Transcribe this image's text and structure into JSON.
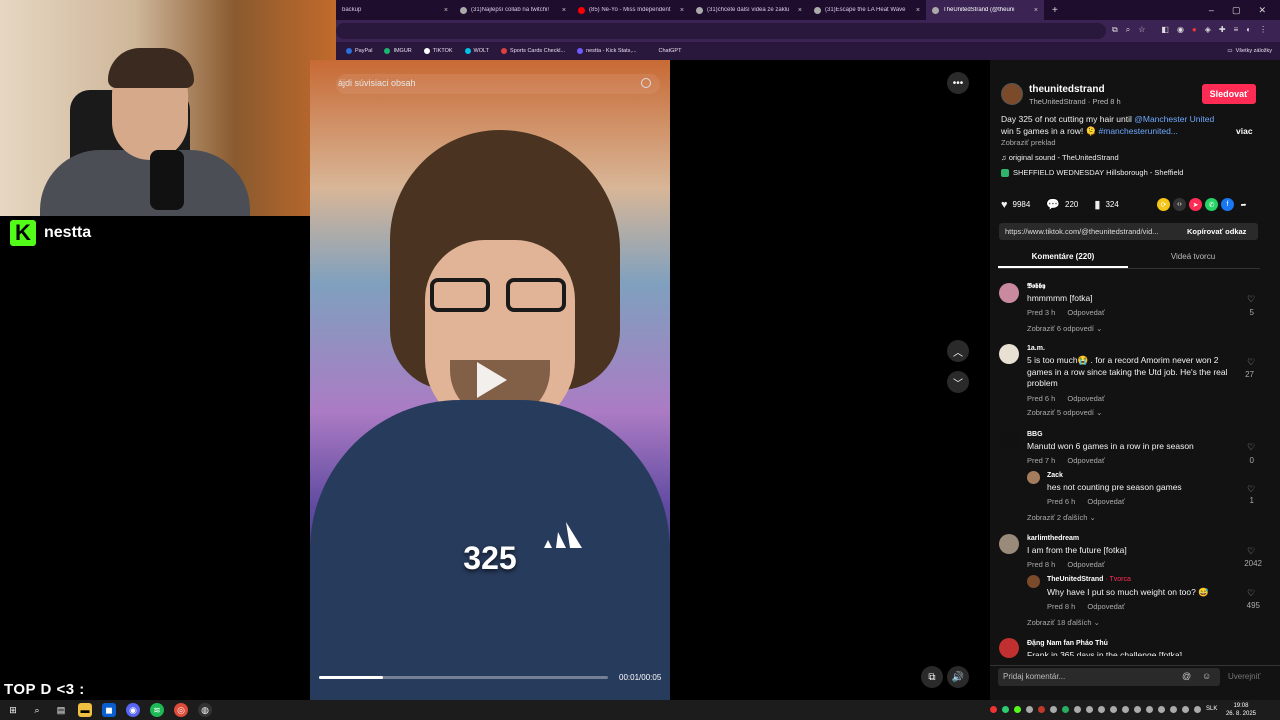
{
  "browser": {
    "tabs": [
      {
        "title": "backup",
        "active": false
      },
      {
        "title": "(31)Najlepší collab na twitchi!",
        "active": false
      },
      {
        "title": "(85) Ne-Yo - Miss Independent",
        "active": false
      },
      {
        "title": "(31)chcete další videa ze zaklu",
        "active": false
      },
      {
        "title": "(31)Escape the LA Heat Wave",
        "active": false
      },
      {
        "title": "TheUnitedStrand (@theuni",
        "active": true
      }
    ],
    "bookmarks": [
      {
        "label": "PayPal",
        "color": "#2a6fdb"
      },
      {
        "label": "IMGUR",
        "color": "#1bb76e"
      },
      {
        "label": "TIKTOK",
        "color": "#ffffff"
      },
      {
        "label": "WOLT",
        "color": "#00c2e8"
      },
      {
        "label": "Sports Cards Checkl...",
        "color": "#e04040"
      },
      {
        "label": "nestta - Kick Stats,...",
        "color": "#6f5bff"
      },
      {
        "label": "ChatGPT",
        "color": "#10a37f"
      }
    ],
    "all_bookmarks": "Všetky záložky"
  },
  "stream": {
    "brand_name": "nestta",
    "brand_logo_letter": "K",
    "overlay_text": "TOP D <3 :"
  },
  "video": {
    "search_placeholder": "ájdi súvisiaci obsah",
    "number_overlay": "325",
    "time": "00:01/00:05",
    "progress_fraction": 0.22
  },
  "post": {
    "author_handle": "theunitedstrand",
    "author_subtitle": "TheUnitedStrand · Pred 8 h",
    "follow_label": "Sledovať",
    "description_part1": "Day 325 of not cutting my hair until ",
    "mention": "@Manchester United",
    "description_part2": "win 5 games in a row! 🫠 ",
    "hashtag": "#manchesterunited...",
    "more_label": "viac",
    "translate_label": "Zobraziť preklad",
    "music": "original sound - TheUnitedStrand",
    "place": "SHEFFIELD WEDNESDAY Hillsborough - Sheffield",
    "likes": "9984",
    "comments": "220",
    "saves": "324",
    "link_url": "https://www.tiktok.com/@theunitedstrand/vid...",
    "copy_link_label": "Kopírovať odkaz",
    "tab_comments": "Komentáre (220)",
    "tab_creator": "Videá tvorcu"
  },
  "comments": [
    {
      "user": "𝕭𝖔𝖇𝖇𝖞",
      "text": "hmmmmm [fotka]",
      "time": "Pred 3 h",
      "reply": "Odpovedať",
      "replies": "Zobraziť 6 odpovedí ⌄",
      "likes": "5"
    },
    {
      "user": "1a.m.",
      "text": "5 is too much😭 . for a record Amorim never won 2 games in a row since taking the Utd job. He's the real problem",
      "time": "Pred 6 h",
      "reply": "Odpovedať",
      "replies": "Zobraziť 5 odpovedí ⌄",
      "likes": "27"
    },
    {
      "user": "BBG",
      "text": "Manutd won 6 games in a row in pre season",
      "time": "Pred 7 h",
      "reply": "Odpovedať",
      "likes": "0",
      "sub": {
        "user": "Zack",
        "text": "hes not counting pre season games",
        "time": "Pred 6 h",
        "reply": "Odpovedať",
        "likes": "1"
      },
      "replies": "Zobraziť 2 ďalších ⌄"
    },
    {
      "user": "karlimthedream",
      "text": "I am from the future [fotka]",
      "time": "Pred 8 h",
      "reply": "Odpovedať",
      "likes": "2042",
      "sub": {
        "user": "TheUnitedStrand",
        "badge": " · Tvorca",
        "text": "Why have I put so much weight on too? 😅",
        "time": "Pred 8 h",
        "reply": "Odpovedať",
        "likes": "495"
      },
      "replies": "Zobraziť 18 ďalších ⌄"
    },
    {
      "user": "Đặng Nam fan Pháo Thủ",
      "text": "Frank in 365 days in the challenge [fotka]"
    }
  ],
  "comment_box": {
    "placeholder": "Pridaj komentár...",
    "publish": "Uverejniť"
  },
  "taskbar": {
    "lang": "SLK",
    "time": "19:08",
    "date": "26. 8. 2025"
  },
  "colors": {
    "accent": "#fe2c55",
    "mention": "#6fa8ff",
    "brand": "#53fc18"
  }
}
